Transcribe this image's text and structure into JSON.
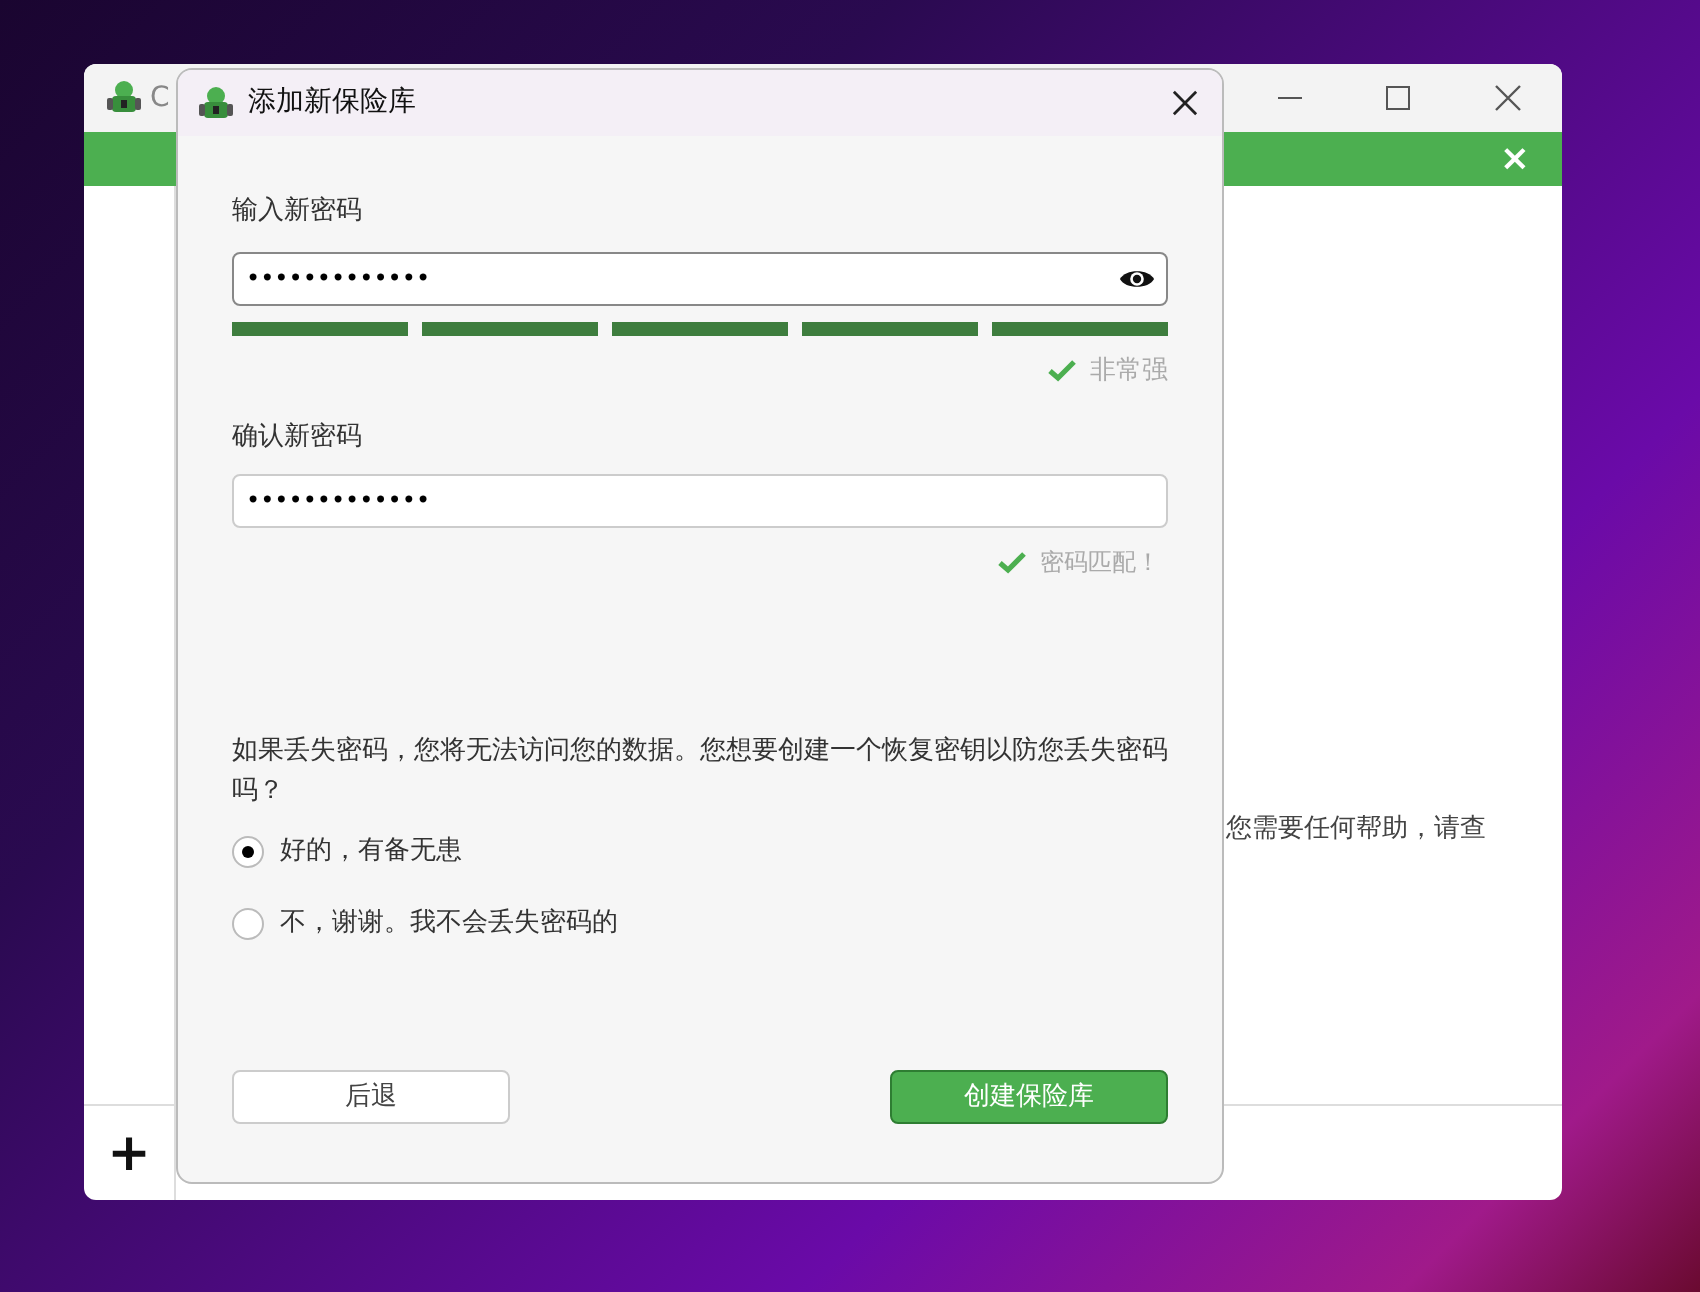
{
  "background_window": {
    "title": "C",
    "banner_close": "×",
    "body_text": "您需要任何帮助，请查",
    "add_button": "+"
  },
  "dialog": {
    "title": "添加新保险库",
    "new_password": {
      "label": "输入新密码",
      "value": "•••••••••••••",
      "strength": {
        "segments": [
          {
            "on": true
          },
          {
            "on": true
          },
          {
            "on": true
          },
          {
            "on": true
          },
          {
            "on": true
          }
        ],
        "label": "非常强"
      }
    },
    "confirm_password": {
      "label": "确认新密码",
      "value": "•••••••••••••",
      "match": {
        "ok": true,
        "label": "密码匹配！"
      }
    },
    "question": "如果丢失密码，您将无法访问您的数据。您想要创建一个恢复密钥以防您丢失密码吗？",
    "options": [
      {
        "label": "好的，有备无患",
        "selected": true
      },
      {
        "label": "不，谢谢。我不会丢失密码的",
        "selected": false
      }
    ],
    "back_button": "后退",
    "create_button": "创建保险库"
  }
}
